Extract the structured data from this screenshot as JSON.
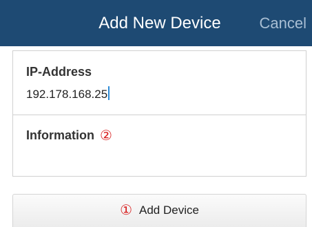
{
  "header": {
    "title": "Add New Device",
    "cancel_label": "Cancel"
  },
  "form": {
    "ip": {
      "label": "IP-Address",
      "value": "192.178.168.25"
    },
    "info": {
      "label": "Information",
      "marker": "②",
      "value": ""
    }
  },
  "button": {
    "marker": "①",
    "label": "Add Device"
  },
  "colors": {
    "header_bg": "#1e4a73",
    "cancel_text": "#a9bfd4",
    "marker_red": "#d81e1e",
    "caret": "#2b8ad6"
  }
}
